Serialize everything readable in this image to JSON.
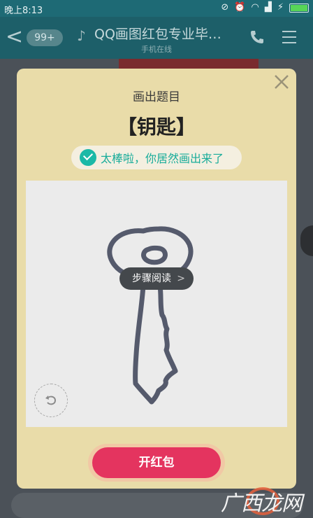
{
  "status_bar": {
    "time": "晚上8:13"
  },
  "header": {
    "back_label": "<",
    "badge": "99+",
    "title": "QQ画图红包专业毕…",
    "subtitle": "手机在线"
  },
  "modal": {
    "title": "画出题目",
    "word": "【钥匙】",
    "success_text": "太棒啦，你居然画出来了",
    "read_label": "步骤阅读",
    "read_chevron": ">",
    "open_button": "开红包"
  },
  "icons": [
    "back-chevron-icon",
    "ear-icon",
    "phone-icon",
    "menu-icon",
    "close-icon",
    "check-icon",
    "undo-icon"
  ],
  "colors": {
    "header_bg": "#1d5f69",
    "modal_bg": "#e9dca9",
    "success_green": "#19ac9a",
    "open_button_red": "#e4345f",
    "drawing_stroke": "#555a6c"
  },
  "watermark": {
    "text": "广西龙网"
  }
}
